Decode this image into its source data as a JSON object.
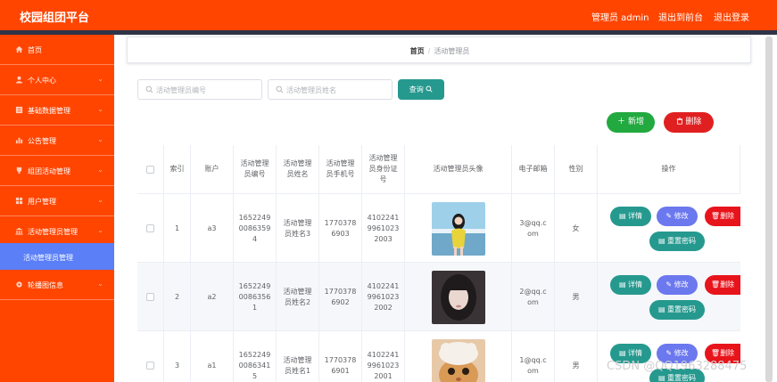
{
  "header": {
    "app_title": "校园组团平台",
    "admin_label": "管理员 admin",
    "back_label": "退出到前台",
    "logout_label": "退出登录"
  },
  "sidebar": {
    "items": [
      {
        "label": "首页",
        "icon": "home-icon",
        "arrow": ""
      },
      {
        "label": "个人中心",
        "icon": "user-icon",
        "arrow": "⌄"
      },
      {
        "label": "基础数据管理",
        "icon": "grid-icon",
        "arrow": "⌄"
      },
      {
        "label": "公告管理",
        "icon": "chart-icon",
        "arrow": "⌄"
      },
      {
        "label": "组团活动管理",
        "icon": "trophy-icon",
        "arrow": "⌄"
      },
      {
        "label": "用户管理",
        "icon": "apps-icon",
        "arrow": "⌄"
      },
      {
        "label": "活动管理员管理",
        "icon": "bank-icon",
        "arrow": "⌄"
      },
      {
        "label": "轮播图信息",
        "icon": "gear-icon",
        "arrow": "⌄"
      }
    ],
    "active_sub": "活动管理员管理"
  },
  "breadcrumb": {
    "home": "首页",
    "separator": "/",
    "current": "活动管理员"
  },
  "search": {
    "id_placeholder": "活动管理员编号",
    "name_placeholder": "活动管理员姓名",
    "query_label": "查询"
  },
  "actions": {
    "add_label": "新增",
    "delete_label": "删除"
  },
  "table": {
    "headers": [
      "索引",
      "账户",
      "活动管理\n员编号",
      "活动管理\n员姓名",
      "活动管理\n员手机号",
      "活动管理\n员身份证\n号",
      "活动管理员头像",
      "电子邮箱",
      "性别",
      "操作"
    ],
    "rows": [
      {
        "index": "1",
        "account": "a3",
        "number": "1652249\n0086359\n4",
        "name": "活动管理\n员姓名3",
        "phone": "1770378\n6903",
        "idcard": "4102241\n9961023\n2003",
        "email": "3@qq.c\nom",
        "gender": "女"
      },
      {
        "index": "2",
        "account": "a2",
        "number": "1652249\n0086356\n1",
        "name": "活动管理\n员姓名2",
        "phone": "1770378\n6902",
        "idcard": "4102241\n9961023\n2002",
        "email": "2@qq.c\nom",
        "gender": "男"
      },
      {
        "index": "3",
        "account": "a1",
        "number": "1652249\n0086341\n5",
        "name": "活动管理\n员姓名1",
        "phone": "1770378\n6901",
        "idcard": "4102241\n9961023\n2001",
        "email": "1@qq.c\nom",
        "gender": "男"
      }
    ],
    "op_detail": "详情",
    "op_edit": "修改",
    "op_delete": "删除",
    "op_reset": "重置密码"
  },
  "watermark": "CSDN @QQ1963288475",
  "colors": {
    "header": "#ff4500",
    "sidebar_active": "#5a7ff7",
    "teal": "#26998f",
    "green": "#22a93f",
    "red": "#e02020",
    "purple": "#6b78ee"
  }
}
